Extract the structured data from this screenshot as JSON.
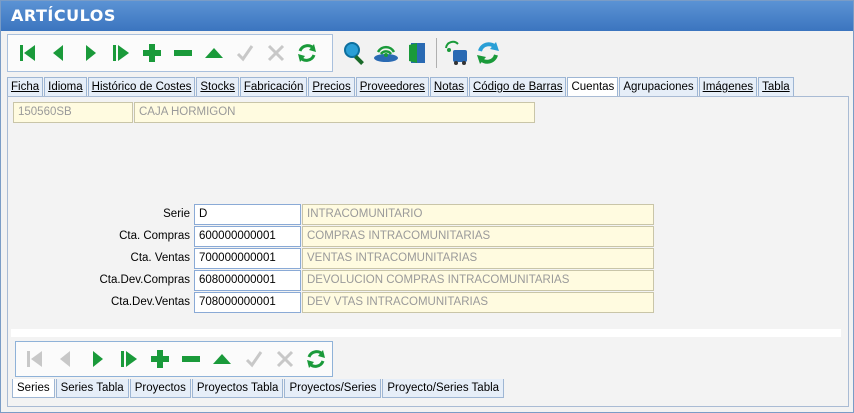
{
  "window": {
    "title": "ARTÍCULOS"
  },
  "toolbar": {
    "buttons": [
      {
        "icon": "first-record-icon"
      },
      {
        "icon": "previous-record-icon"
      },
      {
        "icon": "next-record-icon"
      },
      {
        "icon": "last-record-icon"
      },
      {
        "icon": "add-icon"
      },
      {
        "icon": "delete-icon"
      },
      {
        "icon": "edit-up-icon"
      },
      {
        "icon": "confirm-icon"
      },
      {
        "icon": "cancel-icon"
      },
      {
        "icon": "refresh-icon"
      }
    ],
    "extra_buttons": [
      {
        "icon": "search-icon"
      },
      {
        "icon": "wireless-icon"
      },
      {
        "icon": "exit-door-icon"
      },
      {
        "icon": "bus-stop-icon"
      },
      {
        "icon": "sync-icon"
      }
    ]
  },
  "tabs": [
    {
      "label": "Ficha"
    },
    {
      "label": "Idioma"
    },
    {
      "label": "Histórico de Costes"
    },
    {
      "label": "Stocks"
    },
    {
      "label": "Fabricación"
    },
    {
      "label": "Precios"
    },
    {
      "label": "Proveedores"
    },
    {
      "label": "Notas"
    },
    {
      "label": "Código de Barras"
    },
    {
      "label": "Cuentas"
    },
    {
      "label": "Agrupaciones"
    },
    {
      "label": "Imágenes"
    },
    {
      "label": "Tabla"
    }
  ],
  "active_tab": "Cuentas",
  "article": {
    "code": "150560SB",
    "description": "CAJA HORMIGON"
  },
  "accounts": [
    {
      "label": "Serie",
      "value": "D",
      "description": "INTRACOMUNITARIO"
    },
    {
      "label": "Cta. Compras",
      "value": "600000000001",
      "description": "COMPRAS INTRACOMUNITARIAS"
    },
    {
      "label": "Cta. Ventas",
      "value": "700000000001",
      "description": "VENTAS INTRACOMUNITARIAS"
    },
    {
      "label": "Cta.Dev.Compras",
      "value": "608000000001",
      "description": "DEVOLUCION COMPRAS INTRACOMUNITARIAS"
    },
    {
      "label": "Cta.Dev.Ventas",
      "value": "708000000001",
      "description": "DEV VTAS INTRACOMUNITARIAS"
    }
  ],
  "sub_toolbar": {
    "buttons": [
      {
        "icon": "first-record-icon"
      },
      {
        "icon": "previous-record-icon"
      },
      {
        "icon": "next-record-icon"
      },
      {
        "icon": "last-record-icon"
      },
      {
        "icon": "add-icon"
      },
      {
        "icon": "delete-icon"
      },
      {
        "icon": "edit-up-icon"
      },
      {
        "icon": "confirm-icon"
      },
      {
        "icon": "cancel-icon"
      },
      {
        "icon": "refresh-icon"
      }
    ]
  },
  "bottom_tabs": [
    {
      "label": "Series"
    },
    {
      "label": "Series Tabla"
    },
    {
      "label": "Proyectos"
    },
    {
      "label": "Proyectos Tabla"
    },
    {
      "label": "Proyectos/Series"
    },
    {
      "label": "Proyecto/Series Tabla"
    }
  ],
  "active_bottom_tab": "Series",
  "colors": {
    "accent_green": "#1a9a3a",
    "title_blue": "#3b75bf",
    "disabled_gray": "#c0c0c0",
    "field_yellow": "#fffbe0"
  }
}
